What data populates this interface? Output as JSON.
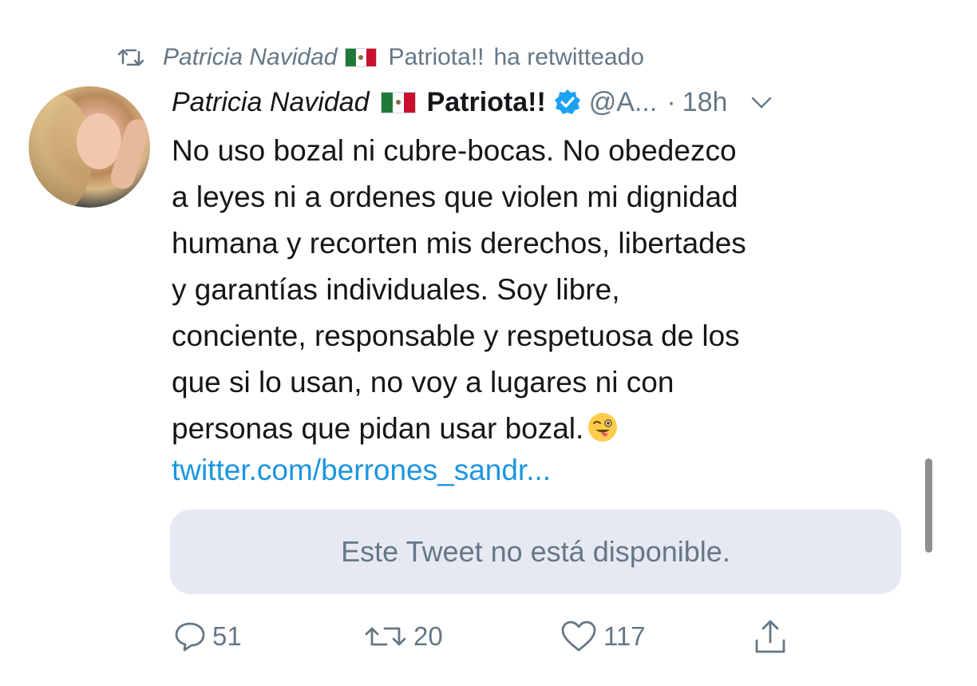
{
  "retweet_banner": {
    "retweeter_name_italic": "Patricia Navidad",
    "retweeter_name_rest": "Patriota!!",
    "action_text": "ha retwitteado"
  },
  "tweet": {
    "author_name_italic": "Patricia Navidad",
    "author_name_bold": "Patriota!!",
    "handle": "@A...",
    "separator": "·",
    "time": "18h",
    "text_lines": [
      "No uso bozal ni cubre-bocas. No obedezco",
      "a leyes ni a ordenes que violen mi dignidad",
      "humana y recorten mis derechos, libertades",
      "y garantías individuales. Soy libre,",
      "conciente, responsable y respetuosa de los",
      "que si lo usan, no voy a lugares ni con",
      "personas que pidan usar bozal."
    ],
    "link": "twitter.com/berrones_sandr...",
    "quoted_unavailable": "Este Tweet no está disponible.",
    "counts": {
      "replies": "51",
      "retweets": "20",
      "likes": "117"
    }
  },
  "icons": {
    "retweet_banner": "retweet-icon",
    "flag": "mexico-flag-icon",
    "verified": "verified-badge-icon",
    "caret": "chevron-down-icon",
    "emoji": "winking-face-with-tongue-emoji",
    "reply": "reply-icon",
    "retweet": "retweet-icon",
    "like": "heart-icon",
    "share": "share-icon"
  },
  "colors": {
    "text": "#14171a",
    "secondary": "#657786",
    "link": "#1b95e0",
    "verified": "#1da1f2",
    "unavailable_bg": "#e6e9f1"
  }
}
